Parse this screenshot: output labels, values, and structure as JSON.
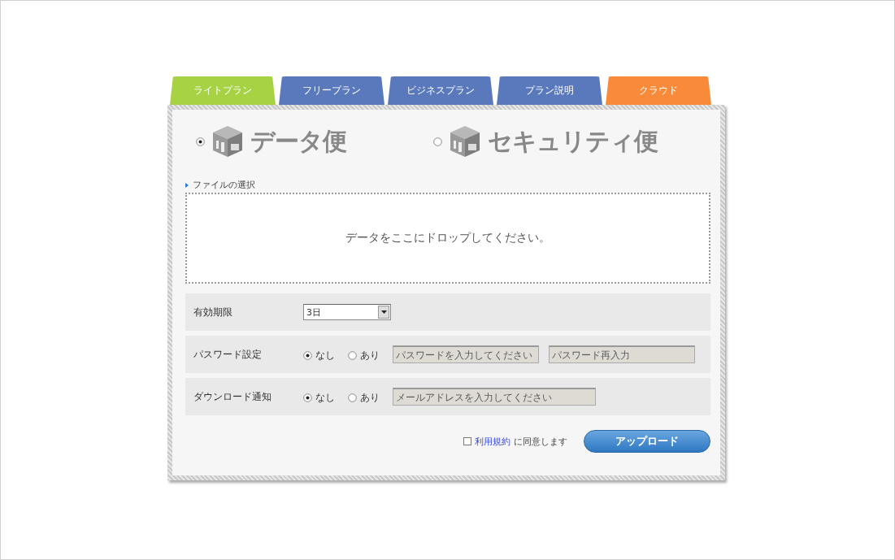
{
  "tabs": [
    {
      "label": "ライトプラン",
      "color": "#a6d243"
    },
    {
      "label": "フリープラン",
      "color": "#5a79bd"
    },
    {
      "label": "ビジネスプラン",
      "color": "#5a79bd"
    },
    {
      "label": "プラン説明",
      "color": "#5a79bd"
    },
    {
      "label": "クラウド",
      "color": "#f98a3a"
    }
  ],
  "services": [
    {
      "label": "データ便",
      "selected": true
    },
    {
      "label": "セキュリティ便",
      "selected": false
    }
  ],
  "file_section": {
    "heading": "ファイルの選択",
    "drop_text": "データをここにドロップしてください。"
  },
  "settings": [
    {
      "kind": "select",
      "label": "有効期限",
      "value": "3日"
    },
    {
      "kind": "radio",
      "label": "パスワード設定",
      "options": [
        {
          "label": "なし",
          "selected": true
        },
        {
          "label": "あり",
          "selected": false
        }
      ],
      "fields": [
        {
          "placeholder": "パスワードを入力してください",
          "disabled": true
        },
        {
          "placeholder": "パスワード再入力",
          "disabled": true
        }
      ]
    },
    {
      "kind": "radio",
      "label": "ダウンロード通知",
      "options": [
        {
          "label": "なし",
          "selected": true
        },
        {
          "label": "あり",
          "selected": false
        }
      ],
      "fields": [
        {
          "placeholder": "メールアドレスを入力してください",
          "disabled": true
        }
      ]
    }
  ],
  "agreement": {
    "checked": false,
    "link": "利用規約",
    "text": "に同意します"
  },
  "upload_button": "アップロード"
}
